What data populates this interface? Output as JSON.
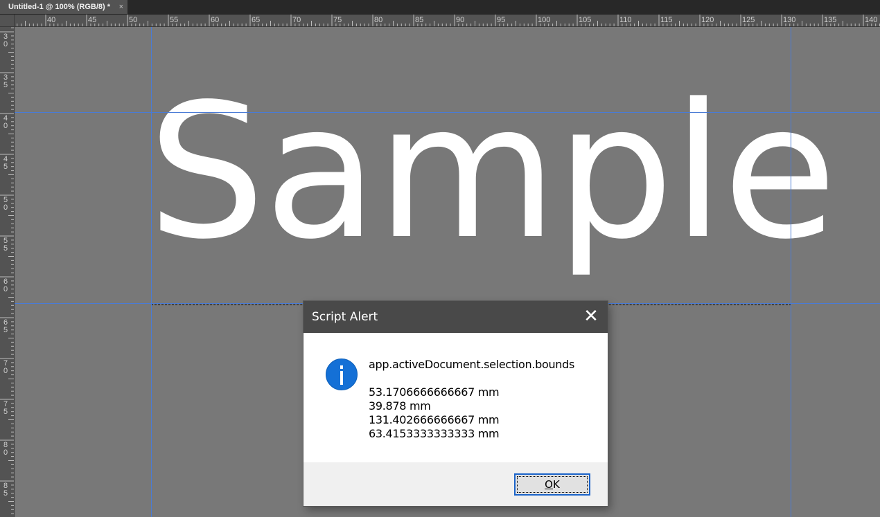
{
  "document_tab": {
    "title": "Untitled-1 @ 100% (RGB/8) *",
    "close_glyph": "×"
  },
  "ruler_top": {
    "labels": [
      "40",
      "45",
      "50",
      "55",
      "60",
      "65",
      "70",
      "75",
      "80",
      "85",
      "90",
      "95",
      "100",
      "105",
      "110",
      "115",
      "120",
      "125",
      "130",
      "135",
      "140"
    ]
  },
  "ruler_left": {
    "labels": [
      [
        "3",
        "0"
      ],
      [
        "3",
        "5"
      ],
      [
        "4",
        "0"
      ],
      [
        "4",
        "5"
      ],
      [
        "5",
        "0"
      ],
      [
        "5",
        "5"
      ],
      [
        "6",
        "0"
      ],
      [
        "6",
        "5"
      ],
      [
        "7",
        "0"
      ],
      [
        "7",
        "5"
      ],
      [
        "8",
        "0"
      ],
      [
        "8",
        "5"
      ]
    ]
  },
  "canvas": {
    "text": "Sample",
    "background": "#787878",
    "guide_color": "#4a7bd6"
  },
  "dialog": {
    "title": "Script Alert",
    "close_glyph": "✕",
    "icon": "info-icon",
    "heading": "app.activeDocument.selection.bounds",
    "lines": [
      "53.1706666666667 mm",
      "39.878 mm",
      "131.402666666667 mm",
      "63.4153333333333 mm"
    ],
    "ok_label_underlined": "O",
    "ok_label_rest": "K"
  }
}
